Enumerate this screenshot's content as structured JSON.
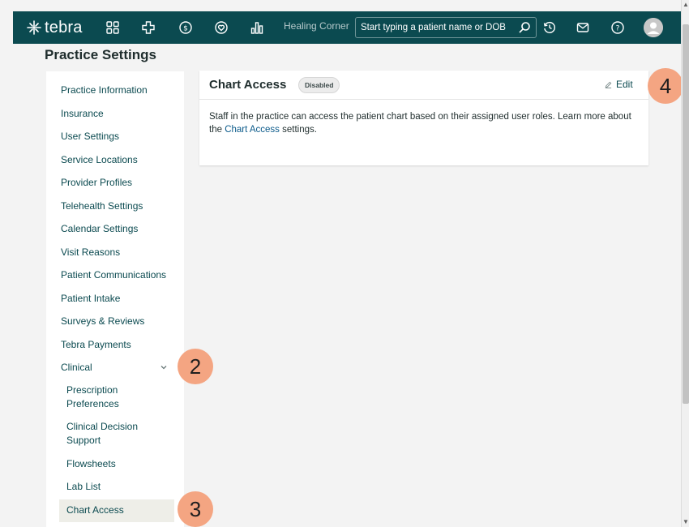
{
  "app": {
    "logo_text": "tebra",
    "practice_name": "Healing Corner"
  },
  "header": {
    "search_placeholder": "Start typing a patient name or DOB",
    "icons": [
      "dashboard-icon",
      "clinical-icon",
      "billing-icon",
      "patient-engagement-icon",
      "reports-icon",
      "history-icon",
      "mail-icon",
      "help-icon",
      "avatar-icon"
    ]
  },
  "page": {
    "title": "Practice Settings"
  },
  "sidebar": {
    "items": [
      {
        "label": "Practice Information"
      },
      {
        "label": "Insurance"
      },
      {
        "label": "User Settings"
      },
      {
        "label": "Service Locations"
      },
      {
        "label": "Provider Profiles"
      },
      {
        "label": "Telehealth Settings"
      },
      {
        "label": "Calendar Settings"
      },
      {
        "label": "Visit Reasons"
      },
      {
        "label": "Patient Communications"
      },
      {
        "label": "Patient Intake"
      },
      {
        "label": "Surveys & Reviews"
      },
      {
        "label": "Tebra Payments"
      },
      {
        "label": "Clinical",
        "expanded": true
      }
    ],
    "subitems": [
      {
        "label": "Prescription Preferences"
      },
      {
        "label": "Clinical Decision Support"
      },
      {
        "label": "Flowsheets"
      },
      {
        "label": "Lab List"
      },
      {
        "label": "Chart Access",
        "selected": true
      }
    ]
  },
  "card": {
    "title": "Chart Access",
    "status_badge": "Disabled",
    "edit_label": "Edit",
    "body_text_before": "Staff in the practice can access the patient chart based on their assigned user roles. Learn more about the ",
    "body_link": "Chart Access",
    "body_text_after": " settings."
  },
  "callouts": [
    "2",
    "3",
    "4"
  ],
  "colors": {
    "header_bg": "#0b4a50",
    "accent": "#0b4a50",
    "callout": "#f4a582",
    "active_item_bg": "#eeeee8"
  }
}
